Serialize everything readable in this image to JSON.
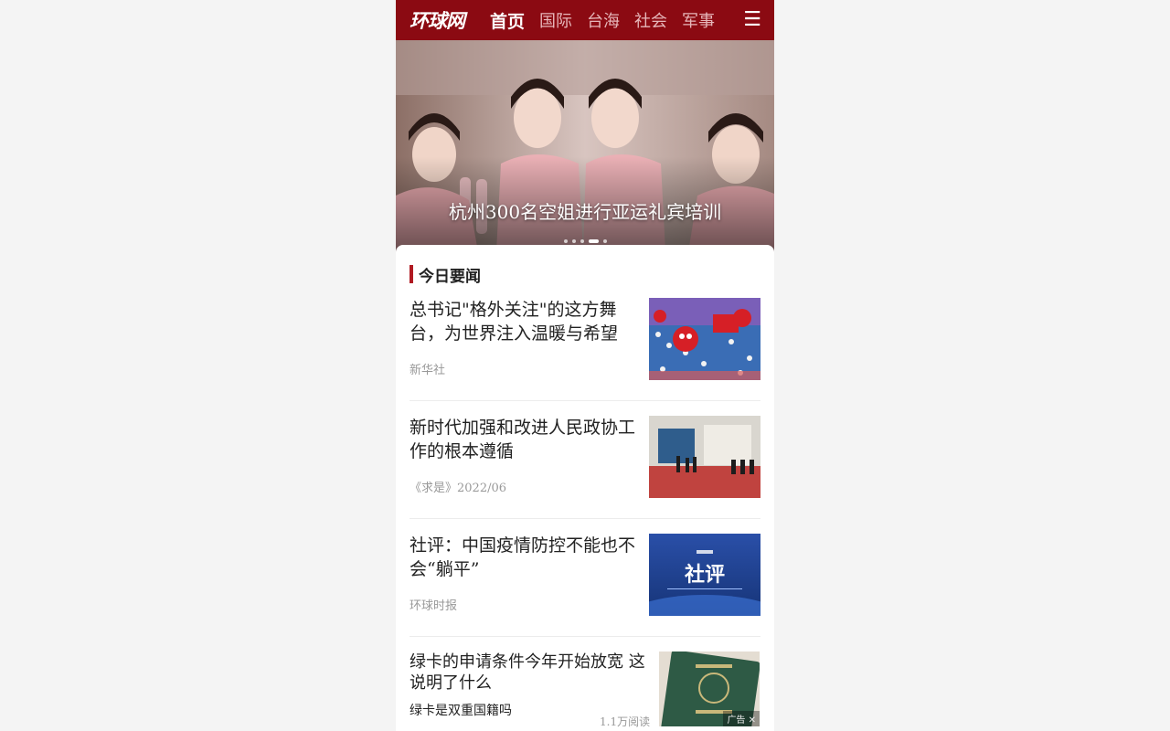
{
  "header": {
    "logo": "环球网",
    "nav": [
      "首页",
      "国际",
      "台海",
      "社会",
      "军事"
    ],
    "menu_glyph": "☰"
  },
  "banner": {
    "caption": "杭州300名空姐进行亚运礼宾培训",
    "slide_count": 5,
    "active_slide": 4
  },
  "section": {
    "title": "今日要闻"
  },
  "news": [
    {
      "title": "总书记\"格外关注\"的这方舞台，为世界注入温暖与希望",
      "source": "新华社"
    },
    {
      "title": "新时代加强和改进人民政协工作的根本遵循",
      "source": "《求是》2022/06"
    },
    {
      "title": "社评：中国疫情防控不能也不会“躺平”",
      "source": "环球时报",
      "thumb_text": "社评"
    }
  ],
  "ad": {
    "title": "绿卡的申请条件今年开始放宽 这说明了什么",
    "subtitle": "绿卡是双重国籍吗",
    "reads": "1.1万阅读",
    "tag": "广告 ✕"
  },
  "colors": {
    "brand": "#8b0a12",
    "accent_bar": "#b01a22"
  }
}
